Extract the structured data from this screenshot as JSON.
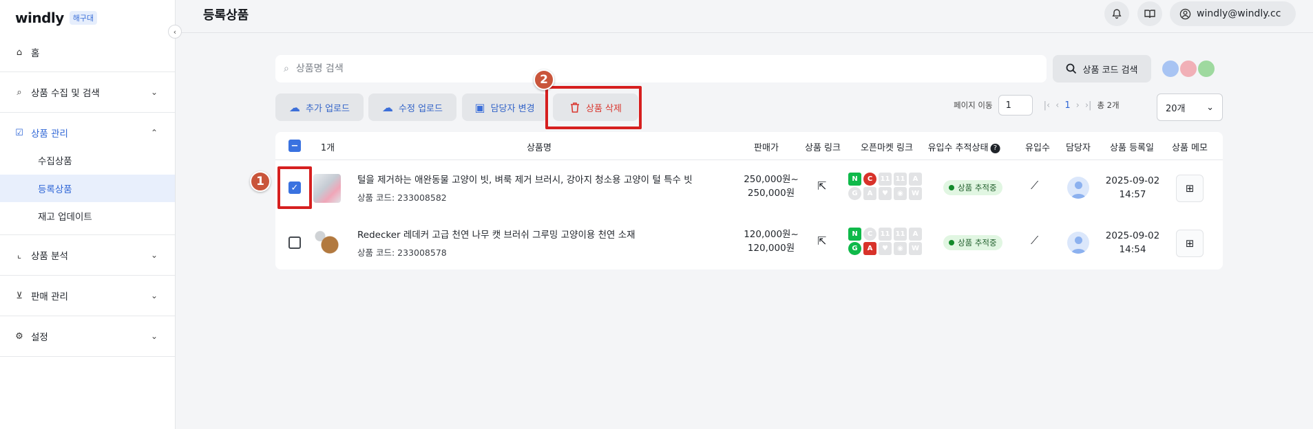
{
  "sidebar": {
    "logo": "windly",
    "badge": "해구대",
    "items": [
      {
        "label": "홈",
        "icon": "home-icon"
      },
      {
        "label": "상품 수집 및 검색",
        "icon": "search-icon"
      },
      {
        "label": "상품 관리",
        "icon": "checkbox-icon",
        "sub": [
          "수집상품",
          "등록상품",
          "재고 업데이트"
        ]
      },
      {
        "label": "상품 분석",
        "icon": "chart-icon"
      },
      {
        "label": "판매 관리",
        "icon": "cart-icon"
      },
      {
        "label": "설정",
        "icon": "gear-icon"
      }
    ]
  },
  "header": {
    "title": "등록상품",
    "user": "windly@windly.cc"
  },
  "search": {
    "placeholder": "상품명 검색",
    "code_button": "상품 코드 검색"
  },
  "actions": {
    "add_upload": "추가 업로드",
    "edit_upload": "수정 업로드",
    "change_assignee": "담당자 변경",
    "delete": "상품 삭제"
  },
  "pager": {
    "label": "페이지 이동",
    "page_value": "1",
    "current": "1",
    "total": "총 2개",
    "per_page": "20개"
  },
  "table": {
    "count": "1개",
    "headers": {
      "name": "상품명",
      "price": "판매가",
      "link": "상품 링크",
      "market": "오픈마켓 링크",
      "tracking": "유입수 추적상태",
      "inflow": "유입수",
      "assignee": "담당자",
      "regdate": "상품 등록일",
      "memo": "상품 메모"
    },
    "rows": [
      {
        "name": "털을 제거하는 애완동물 고양이 빗, 벼룩 제거 브러시, 강아지 청소용 고양이 털 특수 빗",
        "code": "상품 코드: 233008582",
        "price_line1": "250,000원~",
        "price_line2": "250,000원",
        "tracking": "상품 추적중",
        "date": "2025-09-02",
        "time": "14:57",
        "checked": true
      },
      {
        "name": "Redecker 레데커 고급 천연 나무 캣 브러쉬 그루밍 고양이용 천연 소재",
        "code": "상품 코드: 233008578",
        "price_line1": "120,000원~",
        "price_line2": "120,000원",
        "tracking": "상품 추적중",
        "date": "2025-09-02",
        "time": "14:54",
        "checked": false
      }
    ]
  },
  "annotations": {
    "step1": "1",
    "step2": "2",
    "highlight_color": "#d61f1f"
  }
}
